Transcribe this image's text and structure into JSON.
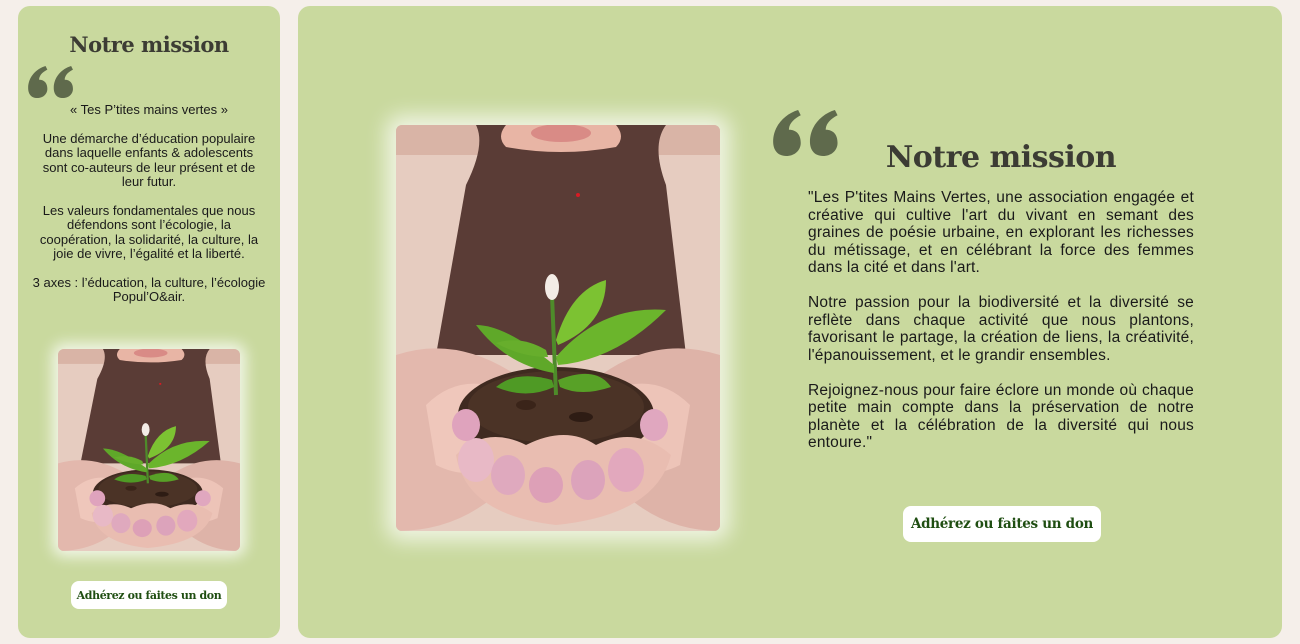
{
  "mobile": {
    "title": "Notre mission",
    "quote_icon": "quote-icon",
    "tagline": "« Tes P’tites mains vertes »",
    "paragraphs": [
      "Une démarche d’éducation populaire dans laquelle enfants & adolescents sont co-auteurs de leur présent et de leur futur.",
      "Les valeurs fondamentales que nous défendons sont l’écologie, la coopération, la solidarité, la culture, la joie de vivre, l’égalité et la liberté.",
      "3 axes : l’éducation, la culture, l’écologie Popul’O&air."
    ],
    "button_label": "Adhérez ou faites un don"
  },
  "desktop": {
    "title": "Notre mission",
    "quote_icon": "quote-icon",
    "paragraphs": [
      "\"Les P'tites Mains Vertes, une association engagée et créative qui cultive l'art du vivant en semant des graines de poésie urbaine, en explorant les richesses du métissage, et en célébrant la force des femmes dans la cité et dans l'art.",
      "Notre passion pour la biodiversité et la diversité se reflète dans chaque activité que nous plantons, favorisant le partage, la création de liens, la créativité, l'épanouissement, et le grandir ensembles.",
      "Rejoignez-nous pour faire éclore un monde où chaque petite main compte dans la préservation de notre planète et la célébration de la diversité qui nous entoure.\""
    ],
    "button_label": "Adhérez ou faites un don"
  },
  "image": {
    "subject": "hands-holding-seedling"
  },
  "colors": {
    "page_background": "#f5efea",
    "panel_background": "#c9d99e",
    "title_text": "#3c3c34",
    "quote_mark": "#5f6a4c",
    "button_background": "#ffffff",
    "button_text": "#1f4e12"
  }
}
